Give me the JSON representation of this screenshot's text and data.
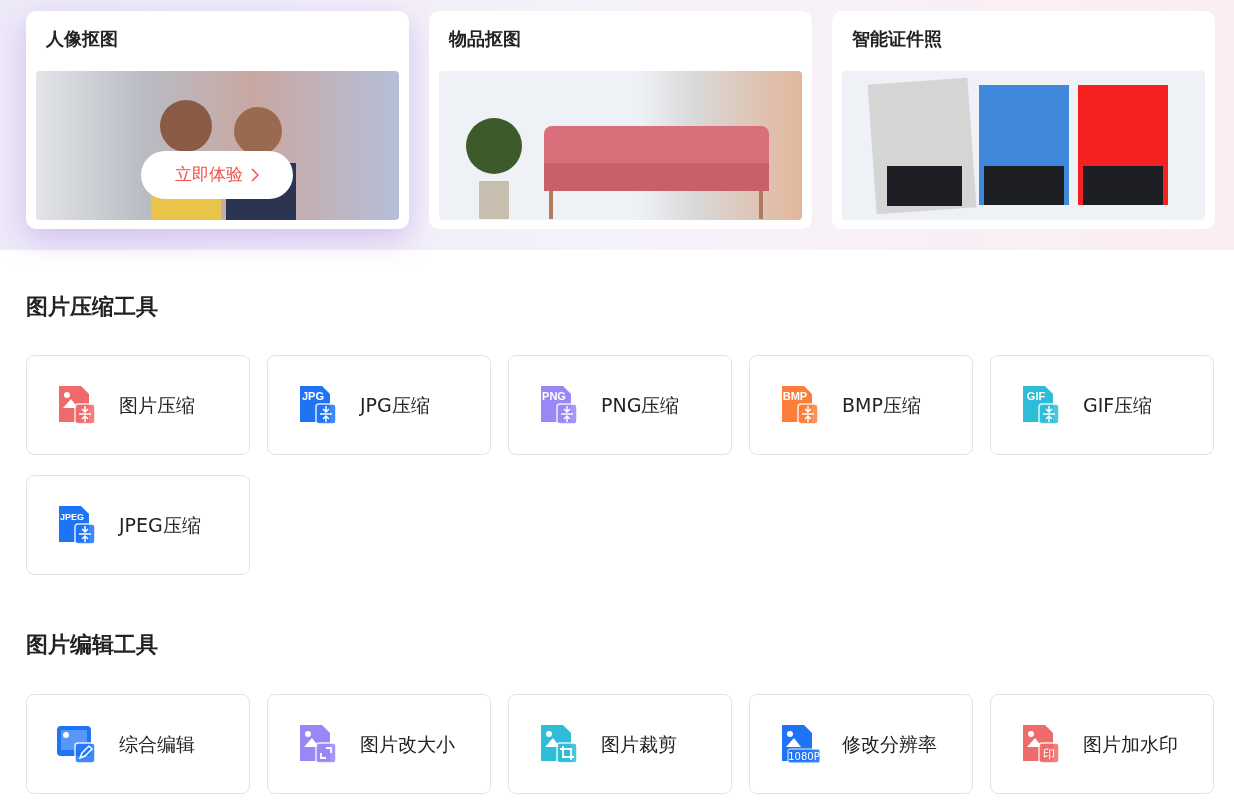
{
  "banner_cards": [
    {
      "title": "人像抠图",
      "highlighted": true,
      "kind": "portrait",
      "action": {
        "label": "立即体验"
      }
    },
    {
      "title": "物品抠图",
      "highlighted": false,
      "kind": "sofa"
    },
    {
      "title": "智能证件照",
      "highlighted": false,
      "kind": "idphoto"
    }
  ],
  "sections": [
    {
      "title": "图片压缩工具",
      "tools": [
        {
          "label": "图片压缩",
          "kind": "photo",
          "color": "#ef6b6b"
        },
        {
          "label": "JPG压缩",
          "kind": "format",
          "icon_text": "JPG",
          "color": "#1f74f5"
        },
        {
          "label": "PNG压缩",
          "kind": "format",
          "icon_text": "PNG",
          "color": "#9a86f5"
        },
        {
          "label": "BMP压缩",
          "kind": "format",
          "icon_text": "BMP",
          "color": "#fb7f3a"
        },
        {
          "label": "GIF压缩",
          "kind": "format",
          "icon_text": "GIF",
          "color": "#2fbcd6"
        },
        {
          "label": "JPEG压缩",
          "kind": "format",
          "icon_text": "JPEG",
          "color": "#1f74f5"
        }
      ]
    },
    {
      "title": "图片编辑工具",
      "tools": [
        {
          "label": "综合编辑",
          "kind": "edit",
          "color": "#1f74f5"
        },
        {
          "label": "图片改大小",
          "kind": "resize",
          "color": "#9a86f5"
        },
        {
          "label": "图片裁剪",
          "kind": "crop",
          "color": "#2fbcd6"
        },
        {
          "label": "修改分辨率",
          "kind": "badge",
          "icon_text": "1080P",
          "color": "#1f74f5"
        },
        {
          "label": "图片加水印",
          "kind": "badge",
          "icon_text": "印",
          "color": "#ef6b6b"
        }
      ]
    }
  ]
}
